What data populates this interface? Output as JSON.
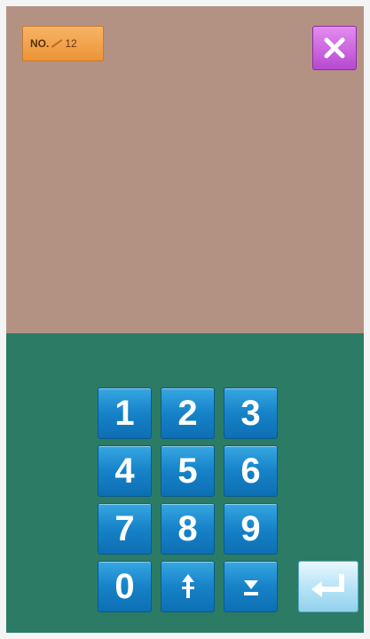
{
  "header": {
    "no_prefix": "NO.",
    "no_value": "12"
  },
  "icons": {
    "close": "close-icon",
    "up": "arrow-up-icon",
    "down": "arrow-down-icon",
    "enter": "enter-icon"
  },
  "keypad": {
    "keys": [
      "1",
      "2",
      "3",
      "4",
      "5",
      "6",
      "7",
      "8",
      "9",
      "0"
    ]
  },
  "colors": {
    "top_area": "#b49283",
    "bottom_area": "#2b7b65",
    "key_blue": "#1682c8",
    "badge_orange": "#ec9437",
    "close_purple": "#b649cf",
    "enter_light": "#b8e4f7"
  }
}
